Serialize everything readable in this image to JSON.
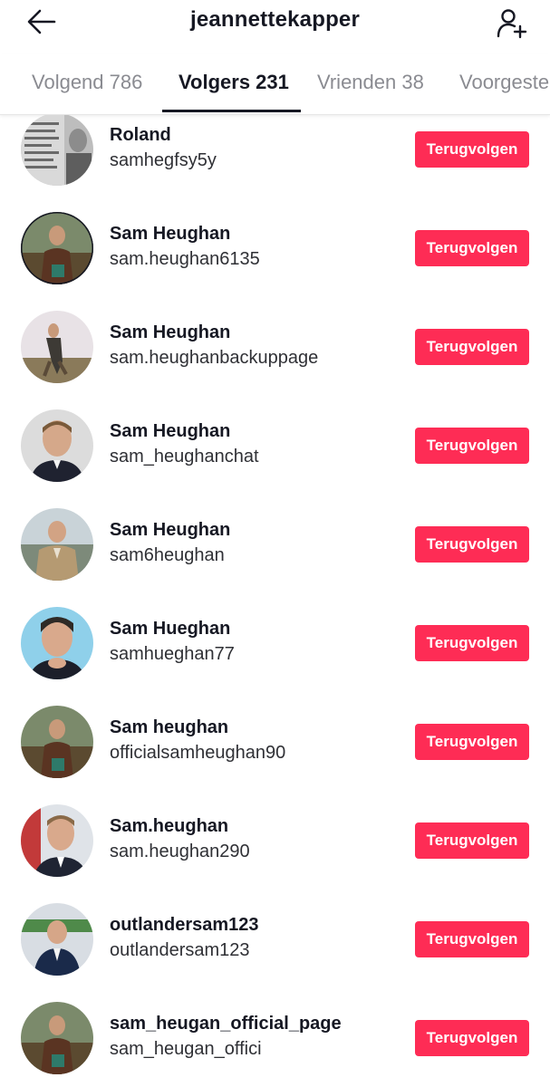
{
  "header": {
    "title": "jeannettekapper",
    "back_icon": "arrow-left-icon",
    "add_icon": "add-person-icon"
  },
  "tabs": [
    {
      "label": "Volgend 786",
      "active": false
    },
    {
      "label": "Volgers 231",
      "active": true
    },
    {
      "label": "Vrienden 38",
      "active": false
    },
    {
      "label": "Voorgeste",
      "active": false
    }
  ],
  "followers": [
    {
      "name": "Roland",
      "handle": "samhegfsy5y",
      "button": "Terugvolgen"
    },
    {
      "name": "Sam Heughan",
      "handle": "sam.heughan6135",
      "button": "Terugvolgen"
    },
    {
      "name": "Sam Heughan",
      "handle": "sam.heughanbackuppage",
      "button": "Terugvolgen"
    },
    {
      "name": "Sam Heughan",
      "handle": "sam_heughanchat",
      "button": "Terugvolgen"
    },
    {
      "name": "Sam Heughan",
      "handle": "sam6heughan",
      "button": "Terugvolgen"
    },
    {
      "name": "Sam Hueghan",
      "handle": "samhueghan77",
      "button": "Terugvolgen"
    },
    {
      "name": "Sam heughan",
      "handle": "officialsamheughan90",
      "button": "Terugvolgen"
    },
    {
      "name": "Sam.heughan",
      "handle": "sam.heughan290",
      "button": "Terugvolgen"
    },
    {
      "name": "outlandersam123",
      "handle": "outlandersam123",
      "button": "Terugvolgen"
    },
    {
      "name": "sam_heugan_official_page",
      "handle": "sam_heugan_offici",
      "button": "Terugvolgen"
    }
  ],
  "colors": {
    "accent": "#fe2c55",
    "text": "#161823",
    "muted_tab": "#8a8b91"
  }
}
